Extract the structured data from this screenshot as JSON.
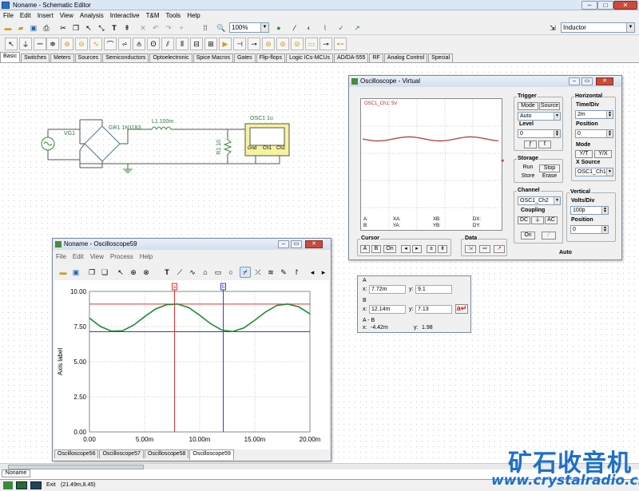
{
  "app": {
    "title": "Noname - Schematic Editor"
  },
  "menu": [
    "File",
    "Edit",
    "Insert",
    "View",
    "Analysis",
    "Interactive",
    "T&M",
    "Tools",
    "Help"
  ],
  "toolbar": {
    "zoom_value": "100%",
    "component_search": "Inductor"
  },
  "component_tabs": [
    "Basic",
    "Switches",
    "Meters",
    "Sources",
    "Semiconductors",
    "Optoelectronic",
    "Spice Macros",
    "Gates",
    "Flip-flops",
    "Logic ICs-MCUs",
    "AD/DA-555",
    "RF",
    "Analog Control",
    "Special"
  ],
  "schematic": {
    "vg_label": "VG1",
    "bridge_label": "GR1 1N1183",
    "inductor_label": "L1 100m",
    "resistor_label": "R1 10",
    "osc_label": "OSC1 1u",
    "osc_pins": [
      "Gnd",
      "Ch1",
      "Ch2"
    ]
  },
  "virtual_osc": {
    "title": "Oscilloscope - Virtual",
    "trace_label": "OSC1_Ch1: 5V",
    "readouts": [
      "A:",
      "XA:",
      "XB:",
      "DX:",
      "B:",
      "YA:",
      "YB:",
      "DY:"
    ],
    "trigger": {
      "label": "Trigger",
      "mode_btn": "Mode",
      "source_btn": "Source",
      "mode_value": "Auto",
      "level_label": "Level",
      "level_value": "0"
    },
    "horizontal": {
      "label": "Horizontal",
      "timediv_label": "Time/Div",
      "timediv_value": "2m",
      "position_label": "Position",
      "position_value": "0",
      "mode_label": "Mode",
      "yt": "Y/T",
      "yx": "Y/X",
      "xsource_label": "X Source",
      "xsource_value": "OSC1_Ch1"
    },
    "storage": {
      "label": "Storage",
      "run": "Run",
      "stop": "Stop",
      "store": "Store",
      "erase": "Erase"
    },
    "channel": {
      "label": "Channel",
      "value": "OSC1_Ch2",
      "coupling_label": "Coupling",
      "dc": "DC",
      "gnd_sym": "⏚",
      "ac": "AC",
      "on": "On"
    },
    "vertical": {
      "label": "Vertical",
      "voltsdiv_label": "Volts/Div",
      "voltsdiv_value": "100p",
      "position_label": "Position",
      "position_value": "0"
    },
    "cursor": {
      "label": "Cursor",
      "a": "A",
      "b": "B",
      "on": "On",
      "left": "◂",
      "right": "▸",
      "pm": "±",
      "down": "⇟"
    },
    "data_label": "Data",
    "auto_label": "Auto"
  },
  "cursor_box": {
    "a_label": "A",
    "a_x": "7.72m",
    "a_y": "9.1",
    "b_label": "B",
    "b_x": "12.14m",
    "b_y": "7.13",
    "ab_label": "A - B",
    "ab_x": "-4.42m",
    "ab_y": "1.98",
    "x_prefix": "x:",
    "y_prefix": "y:"
  },
  "osc59": {
    "title": "Noname - Oscilloscope59",
    "menu": [
      "File",
      "Edit",
      "View",
      "Process",
      "Help"
    ],
    "tabs": [
      "Oscilloscope56",
      "Oscilloscope57",
      "Oscilloscope58",
      "Oscilloscope59"
    ],
    "cursor_a_tag": "a",
    "cursor_b_tag": "b"
  },
  "chart_data": {
    "type": "line",
    "ylabel": "Axis label",
    "xlim": [
      0,
      20
    ],
    "ylim": [
      0,
      10
    ],
    "x_ticks": [
      "0.00",
      "5.00m",
      "10.00m",
      "15.00m",
      "20.00m"
    ],
    "y_ticks": [
      "0.00",
      "2.50",
      "5.00",
      "7.50",
      "10.00"
    ],
    "series": [
      {
        "color": "#1e8a3a",
        "x": [
          0,
          1,
          2,
          3,
          4,
          5,
          6,
          7,
          8,
          9,
          10,
          11,
          12,
          13,
          14,
          15,
          16,
          17,
          18,
          19,
          20
        ],
        "y": [
          8.1,
          7.5,
          7.17,
          7.2,
          7.6,
          8.2,
          8.75,
          9.05,
          9.1,
          8.85,
          8.3,
          7.7,
          7.25,
          7.14,
          7.4,
          7.95,
          8.55,
          9.0,
          9.1,
          8.9,
          8.4
        ]
      }
    ],
    "cursor_a_x": 7.72,
    "cursor_b_x": 12.14,
    "cursor_a_y": 9.1,
    "cursor_b_y": 7.13,
    "grid": true
  },
  "status": {
    "exit": "Exit",
    "coords": "(21.49m,8.45)",
    "tab": "Noname"
  },
  "watermark": {
    "cn": "矿石收音机",
    "url": "www.crystalradio.cn"
  },
  "colors": {
    "cursor_a": "#e03030",
    "cursor_b": "#3040c0",
    "trace": "#1e8a3a",
    "virtual_trace": "#b03030"
  }
}
